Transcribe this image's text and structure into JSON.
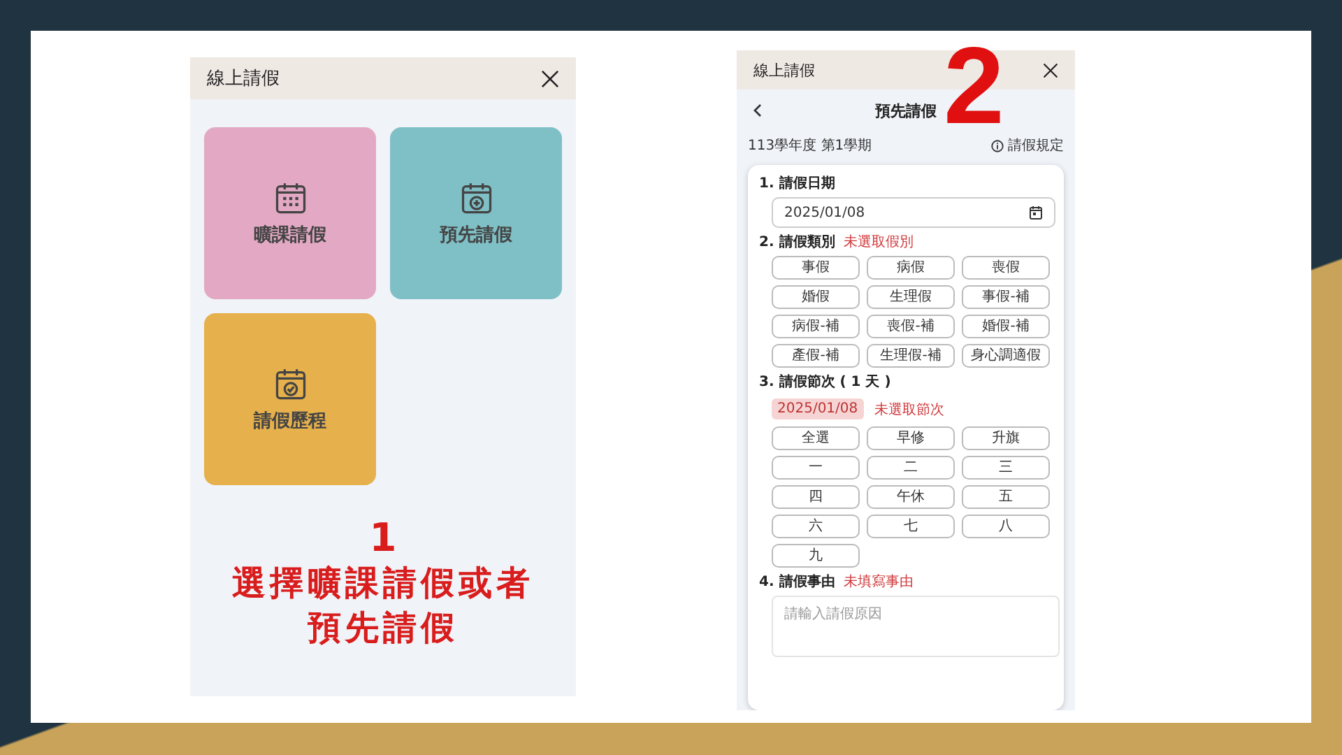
{
  "left_phone": {
    "header": {
      "title": "線上請假"
    },
    "tiles": [
      {
        "label": "曠課請假",
        "color": "#e3a9c4",
        "kind": "grid"
      },
      {
        "label": "預先請假",
        "color": "#7fc0c6",
        "kind": "add"
      },
      {
        "label": "請假歷程",
        "color": "#e6b04c",
        "kind": "check"
      }
    ],
    "caption": {
      "number": "1",
      "lines": [
        "選擇曠課請假或者",
        "預先請假"
      ]
    }
  },
  "right_phone": {
    "step_number": "2",
    "header": {
      "title": "線上請假"
    },
    "nav_title": "預先請假",
    "term": "113學年度 第1學期",
    "rules_link": "請假規定",
    "sections": [
      {
        "kind": "date",
        "number": "1.",
        "title": "請假日期",
        "value": "2025/01/08"
      },
      {
        "kind": "options",
        "number": "2.",
        "title": "請假類別",
        "hint": "未選取假別",
        "options": [
          "事假",
          "病假",
          "喪假",
          "婚假",
          "生理假",
          "事假-補",
          "病假-補",
          "喪假-補",
          "婚假-補",
          "產假-補",
          "生理假-補",
          "身心調適假"
        ]
      },
      {
        "kind": "periods",
        "number": "3.",
        "title": "請假節次 ( 1 天 )",
        "chip": "2025/01/08",
        "hint": "未選取節次",
        "options": [
          "全選",
          "早修",
          "升旗",
          "一",
          "二",
          "三",
          "四",
          "午休",
          "五",
          "六",
          "七",
          "八",
          "九"
        ]
      },
      {
        "kind": "text",
        "number": "4.",
        "title": "請假事由",
        "hint": "未填寫事由",
        "placeholder": "請輸入請假原因"
      }
    ]
  }
}
